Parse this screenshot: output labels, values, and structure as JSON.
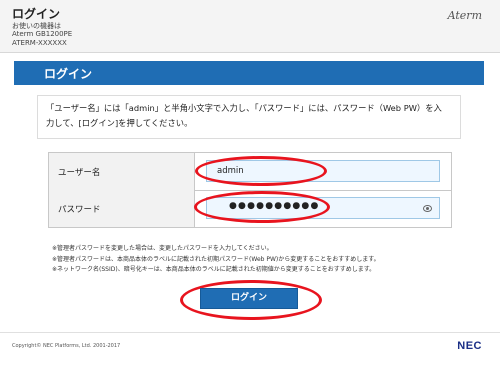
{
  "header": {
    "title": "ログイン",
    "device_label": "お使いの機器は",
    "model": "Aterm GB1200PE",
    "device_id": "ATERM-XXXXXX",
    "brand": "Aterm"
  },
  "banner": {
    "title": "ログイン"
  },
  "instruction": {
    "line1": "「ユーザー名」には「admin」と半角小文字で入力し、「パスワード」には、パスワード（Web PW）を入",
    "line2": "力して、[ログイン]を押してください。"
  },
  "form": {
    "username_label": "ユーザー名",
    "username_value": "admin",
    "password_label": "パスワード",
    "password_mask": "●●●●●●●●●●"
  },
  "notes": [
    "※管理者パスワードを変更した場合は、変更したパスワードを入力してください。",
    "※管理者パスワードは、本商品本体のラベルに記載された初期パスワード(Web PW)から変更することをおすすめします。",
    "※ネットワーク名(SSID)、暗号化キーは、本商品本体のラベルに記載された初期値から変更することをおすすめします。"
  ],
  "login_button": "ログイン",
  "footer": {
    "copyright": "Copyright© NEC Platforms, Ltd. 2001-2017",
    "brand": "NEC"
  },
  "colors": {
    "accent": "#1f6db4",
    "highlight": "#e8141e"
  }
}
